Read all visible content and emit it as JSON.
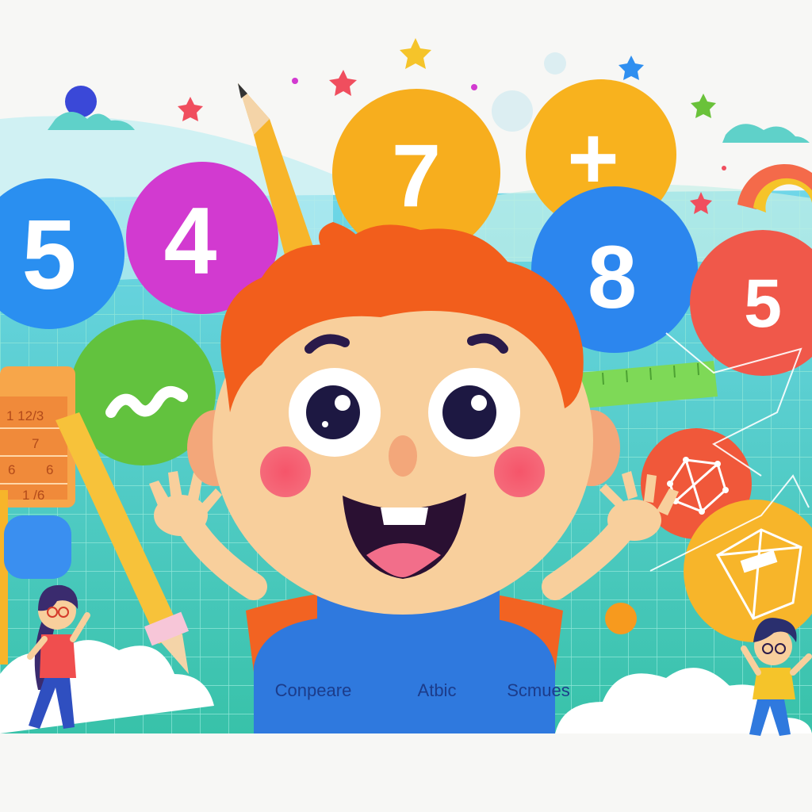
{
  "balls": [
    {
      "label": "5",
      "color": "#2a8ff0"
    },
    {
      "label": "4",
      "color": "#d23ad0"
    },
    {
      "label": "7",
      "color": "#f7ae1e"
    },
    {
      "label": "+",
      "color": "#f8b21e"
    },
    {
      "label": "8",
      "color": "#2c86ee"
    },
    {
      "label": "5",
      "color": "#f0584a"
    }
  ],
  "calculator": {
    "labels": [
      "1 12/3",
      "7",
      "6",
      "6",
      "1 /6"
    ]
  },
  "bottom_labels": {
    "left": "Conpeare",
    "center": "Atbic",
    "right": "Scmues"
  },
  "colors": {
    "background": "#f7f7f5",
    "grid_panel": "#42c7b4",
    "hair": "#f25e1c",
    "skin": "#f8cf9c",
    "overalls": "#2f79de",
    "shirt": "#f26322"
  }
}
